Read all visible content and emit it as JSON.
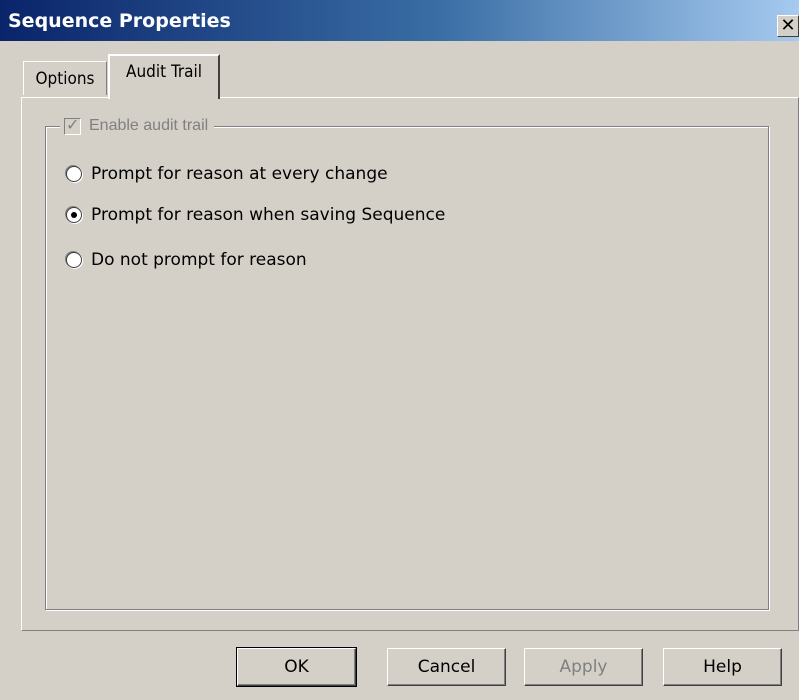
{
  "window": {
    "title": "Sequence Properties",
    "close_label": "X"
  },
  "tabs": [
    {
      "label": "Options",
      "active": false
    },
    {
      "label": "Audit Trail",
      "active": true
    }
  ],
  "audit": {
    "enable_label": "Enable audit trail",
    "enable_checked": true,
    "enable_disabled": true,
    "options": [
      {
        "label": "Prompt for reason at every change",
        "selected": false
      },
      {
        "label": "Prompt for reason when saving Sequence",
        "selected": true
      },
      {
        "label": "Do not prompt for reason",
        "selected": false
      }
    ]
  },
  "buttons": {
    "ok": "OK",
    "cancel": "Cancel",
    "apply": "Apply",
    "help": "Help"
  },
  "icons": {
    "check": "✓",
    "close": "close-icon"
  }
}
